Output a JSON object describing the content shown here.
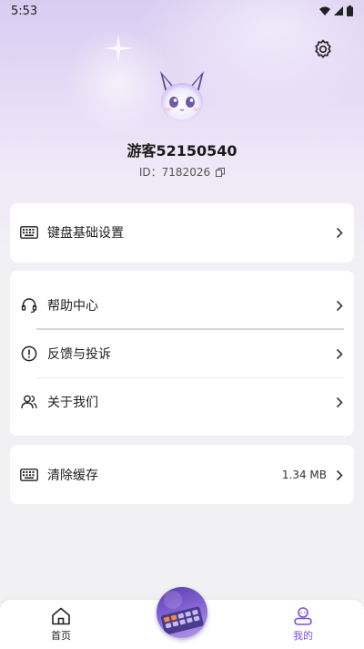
{
  "status": {
    "time": "5:53"
  },
  "profile": {
    "username": "游客52150540",
    "id_label": "ID：",
    "id_value": "7182026"
  },
  "menu": {
    "keyboard_settings": "键盘基础设置",
    "help_center": "帮助中心",
    "feedback": "反馈与投诉",
    "about": "关于我们",
    "clear_cache": "清除缓存",
    "cache_size": "1.34 MB"
  },
  "tabs": {
    "home": "首页",
    "mine": "我的"
  },
  "colors": {
    "accent": "#7b4fe0",
    "hero_top": "#d9ccf2",
    "background": "#f1f1f4"
  },
  "icons": [
    "gear-icon",
    "keyboard-icon",
    "headset-icon",
    "exclamation-circle-icon",
    "users-icon",
    "chevron-right-icon",
    "home-icon",
    "profile-icon",
    "copy-icon",
    "wifi-icon",
    "signal-icon",
    "battery-icon"
  ]
}
